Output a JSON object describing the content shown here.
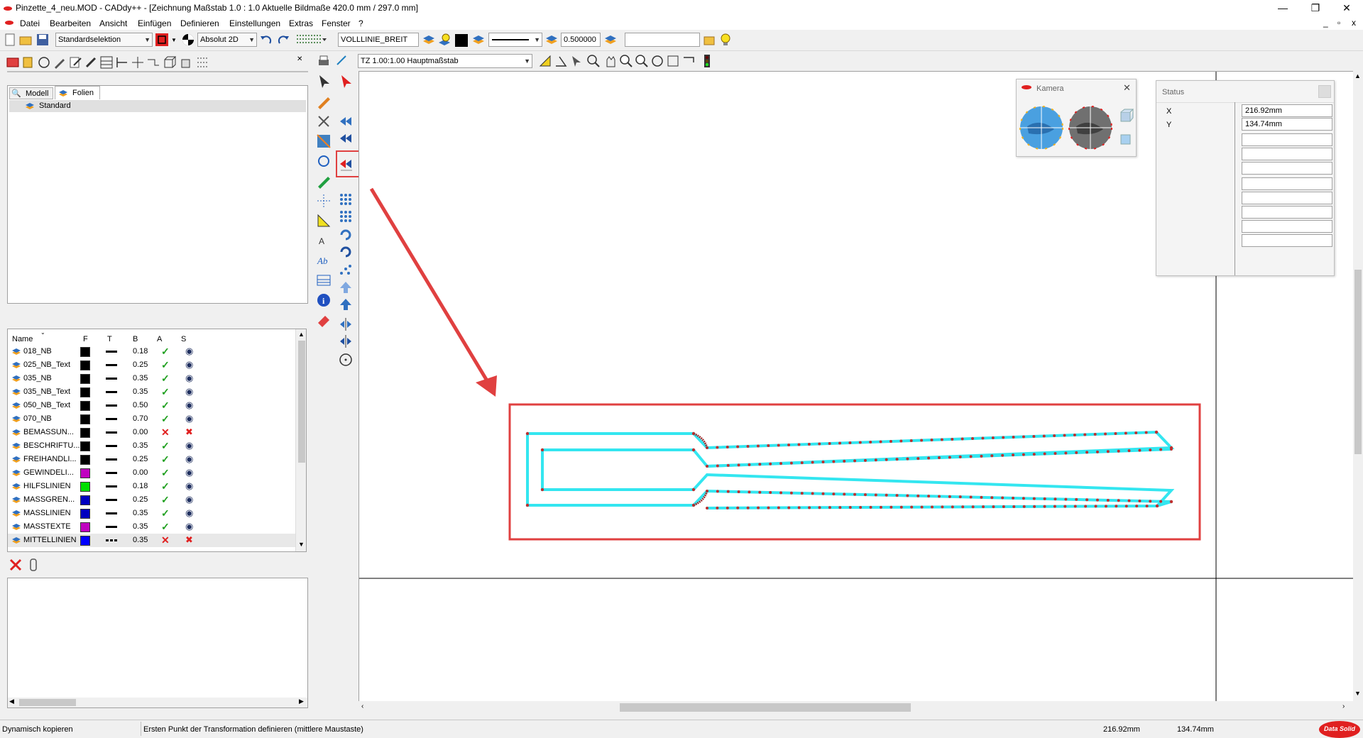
{
  "window": {
    "title": "Pinzette_4_neu.MOD  -  CADdy++ - [Zeichnung    Maßstab 1.0 : 1.0   Aktuelle Bildmaße 420.0 mm / 297.0 mm]",
    "minimize": "—",
    "restore": "❐",
    "close": "✕",
    "inner_min": "_",
    "inner_restore": "▫",
    "inner_close": "x"
  },
  "menu": [
    "Datei",
    "Bearbeiten",
    "Ansicht",
    "Einfügen",
    "Definieren",
    "Einstellungen",
    "Extras",
    "Fenster",
    "?"
  ],
  "toolbar": {
    "selection_mode": "Standardselektion",
    "coord_mode": "Absolut 2D",
    "line_style_name": "VOLLLINIE_BREIT",
    "line_width_value": "0.500000",
    "layer_input": ""
  },
  "toolbar2": {
    "scale_combo": "TZ 1.00:1.00 Hauptmaßstab"
  },
  "left_panel": {
    "tabs": [
      "Modell",
      "Folien"
    ],
    "active_tab": "Folien",
    "tree_root": "Standard",
    "columns": [
      "Name",
      "F",
      "T",
      "B",
      "A",
      "S"
    ],
    "layers": [
      {
        "name": "018_NB",
        "color": "#000000",
        "width": "0.18",
        "active": true,
        "visible": true
      },
      {
        "name": "025_NB_Text",
        "color": "#000000",
        "width": "0.25",
        "active": true,
        "visible": true
      },
      {
        "name": "035_NB",
        "color": "#000000",
        "width": "0.35",
        "active": true,
        "visible": true
      },
      {
        "name": "035_NB_Text",
        "color": "#000000",
        "width": "0.35",
        "active": true,
        "visible": true
      },
      {
        "name": "050_NB_Text",
        "color": "#000000",
        "width": "0.50",
        "active": true,
        "visible": true
      },
      {
        "name": "070_NB",
        "color": "#000000",
        "width": "0.70",
        "active": true,
        "visible": true
      },
      {
        "name": "BEMASSUN...",
        "color": "#000000",
        "width": "0.00",
        "active": false,
        "visible": false
      },
      {
        "name": "BESCHRIFTU...",
        "color": "#000000",
        "width": "0.35",
        "active": true,
        "visible": true
      },
      {
        "name": "FREIHANDLI...",
        "color": "#000000",
        "width": "0.25",
        "active": true,
        "visible": true
      },
      {
        "name": "GEWINDELI...",
        "color": "#c000c0",
        "width": "0.00",
        "active": true,
        "visible": true
      },
      {
        "name": "HILFSLINIEN",
        "color": "#00e000",
        "width": "0.18",
        "active": true,
        "visible": true
      },
      {
        "name": "MASSGREN...",
        "color": "#0000c0",
        "width": "0.25",
        "active": true,
        "visible": true
      },
      {
        "name": "MASSLINIEN",
        "color": "#0000c0",
        "width": "0.35",
        "active": true,
        "visible": true
      },
      {
        "name": "MASSTEXTE",
        "color": "#c000c0",
        "width": "0.35",
        "active": true,
        "visible": true
      },
      {
        "name": "MITTELLINIEN",
        "color": "#0000ff",
        "width": "0.35",
        "active": false,
        "visible": false
      }
    ]
  },
  "camera_window": {
    "title": "Kamera"
  },
  "status_window": {
    "title": "Status",
    "x_label": "X",
    "y_label": "Y",
    "x_value": "216.92mm",
    "y_value": "134.74mm"
  },
  "statusbar": {
    "mode": "Dynamisch kopieren",
    "prompt": "Ersten Punkt der Transformation definieren (mittlere Maustaste)",
    "x": "216.92mm",
    "y": "134.74mm",
    "logo": "Data Solid"
  },
  "colors": {
    "accent_red": "#e03030",
    "shape_cyan": "#33e6f0",
    "point_red": "#c03030"
  }
}
